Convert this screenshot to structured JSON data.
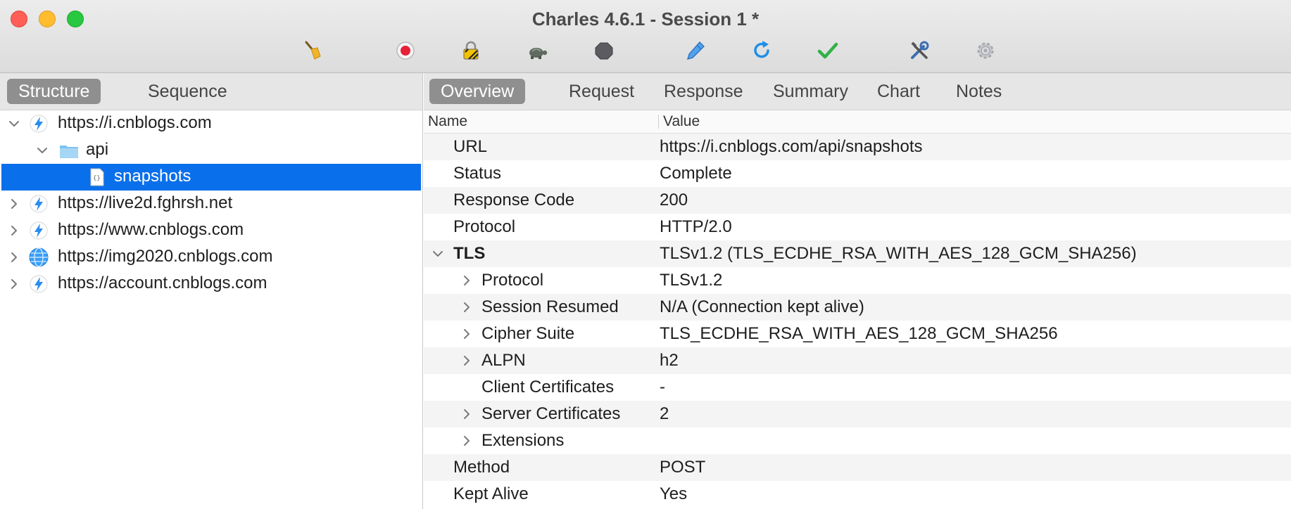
{
  "window": {
    "title": "Charles 4.6.1 - Session 1 *"
  },
  "toolbar": {
    "tools": [
      {
        "name": "broom-icon"
      },
      {
        "name": "record-icon"
      },
      {
        "name": "ssl-lock-icon"
      },
      {
        "name": "turtle-throttle-icon"
      },
      {
        "name": "stop-breakpoints-icon"
      },
      {
        "name": "compose-pen-icon"
      },
      {
        "name": "repeat-icon"
      },
      {
        "name": "validate-check-icon"
      },
      {
        "name": "tools-icon"
      },
      {
        "name": "settings-gear-icon"
      }
    ]
  },
  "left": {
    "tabs": [
      {
        "label": "Structure",
        "active": true
      },
      {
        "label": "Sequence",
        "active": false
      }
    ],
    "tree": [
      {
        "label": "https://i.cnblogs.com",
        "icon": "lightning-icon",
        "expanded": true
      },
      {
        "label": "api",
        "icon": "folder-icon",
        "expanded": true
      },
      {
        "label": "snapshots",
        "icon": "json-file-icon",
        "selected": true
      },
      {
        "label": "https://live2d.fghrsh.net",
        "icon": "lightning-icon"
      },
      {
        "label": "https://www.cnblogs.com",
        "icon": "lightning-icon"
      },
      {
        "label": "https://img2020.cnblogs.com",
        "icon": "globe-icon"
      },
      {
        "label": "https://account.cnblogs.com",
        "icon": "lightning-icon"
      }
    ]
  },
  "right": {
    "tabs": [
      {
        "label": "Overview",
        "active": true
      },
      {
        "label": "Request"
      },
      {
        "label": "Response"
      },
      {
        "label": "Summary"
      },
      {
        "label": "Chart"
      },
      {
        "label": "Notes"
      }
    ],
    "columns": {
      "name": "Name",
      "value": "Value"
    },
    "rows": [
      {
        "name": "URL",
        "value": "https://i.cnblogs.com/api/snapshots"
      },
      {
        "name": "Status",
        "value": "Complete"
      },
      {
        "name": "Response Code",
        "value": "200"
      },
      {
        "name": "Protocol",
        "value": "HTTP/2.0"
      },
      {
        "name": "TLS",
        "value": "TLSv1.2 (TLS_ECDHE_RSA_WITH_AES_128_GCM_SHA256)",
        "bold": true,
        "expanded": true
      },
      {
        "name": "Protocol",
        "value": "TLSv1.2",
        "child": true,
        "collapsed": true
      },
      {
        "name": "Session Resumed",
        "value": "N/A (Connection kept alive)",
        "child": true,
        "collapsed": true
      },
      {
        "name": "Cipher Suite",
        "value": "TLS_ECDHE_RSA_WITH_AES_128_GCM_SHA256",
        "child": true,
        "collapsed": true
      },
      {
        "name": "ALPN",
        "value": "h2",
        "child": true,
        "collapsed": true
      },
      {
        "name": "Client Certificates",
        "value": "-",
        "child": true
      },
      {
        "name": "Server Certificates",
        "value": "2",
        "child": true,
        "collapsed": true
      },
      {
        "name": "Extensions",
        "value": "",
        "child": true,
        "collapsed": true
      },
      {
        "name": "Method",
        "value": "POST"
      },
      {
        "name": "Kept Alive",
        "value": "Yes"
      }
    ]
  },
  "colors": {
    "selection": "#0a6fea",
    "accent_tab": "#8f8f8f"
  }
}
